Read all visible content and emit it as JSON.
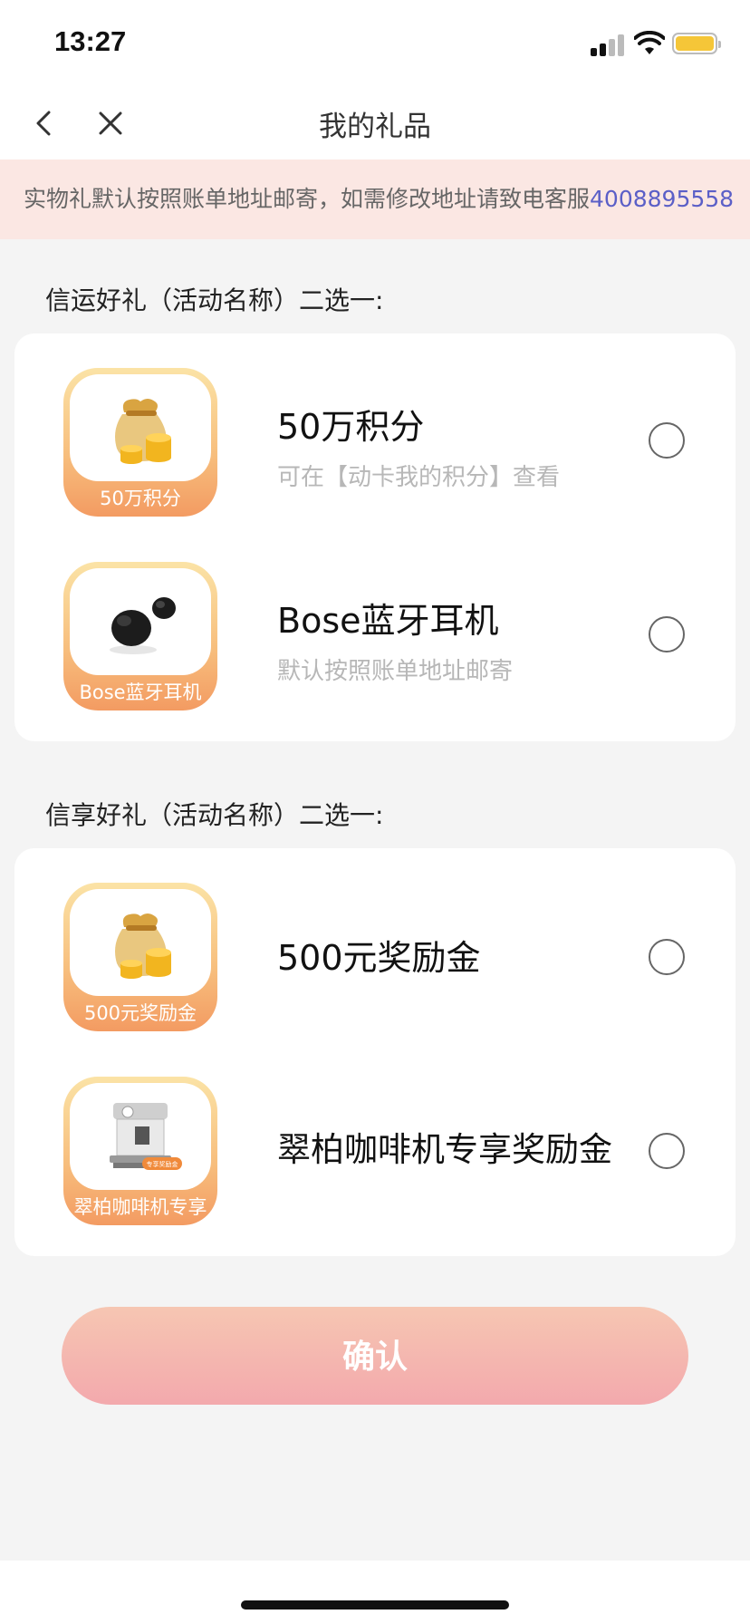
{
  "status": {
    "time": "13:27"
  },
  "nav": {
    "title": "我的礼品"
  },
  "notice": {
    "text": "实物礼默认按照账单地址邮寄，如需修改地址请致电客服",
    "phone": "4008895558"
  },
  "sections": [
    {
      "title": "信运好礼（活动名称）二选一:",
      "gifts": [
        {
          "name": "50万积分",
          "desc": "可在【动卡我的积分】查看",
          "thumb_label": "50万积分",
          "icon": "money-bag-icon"
        },
        {
          "name": "Bose蓝牙耳机",
          "desc": "默认按照账单地址邮寄",
          "thumb_label": "Bose蓝牙耳机",
          "icon": "earbuds-icon"
        }
      ]
    },
    {
      "title": "信享好礼（活动名称）二选一:",
      "gifts": [
        {
          "name": "500元奖励金",
          "desc": "",
          "thumb_label": "500元奖励金",
          "icon": "money-bag-icon"
        },
        {
          "name": "翠柏咖啡机专享奖励金",
          "desc": "",
          "thumb_label": "翠柏咖啡机专享",
          "icon": "coffee-machine-icon",
          "badge": "专享奖励金"
        }
      ]
    }
  ],
  "confirm_label": "确认",
  "colors": {
    "notice_bg": "#fbe7e3",
    "phone_link": "#5b5fc7",
    "button_gradient_top": "#f6c6b2",
    "button_gradient_bottom": "#f3a9ad"
  }
}
